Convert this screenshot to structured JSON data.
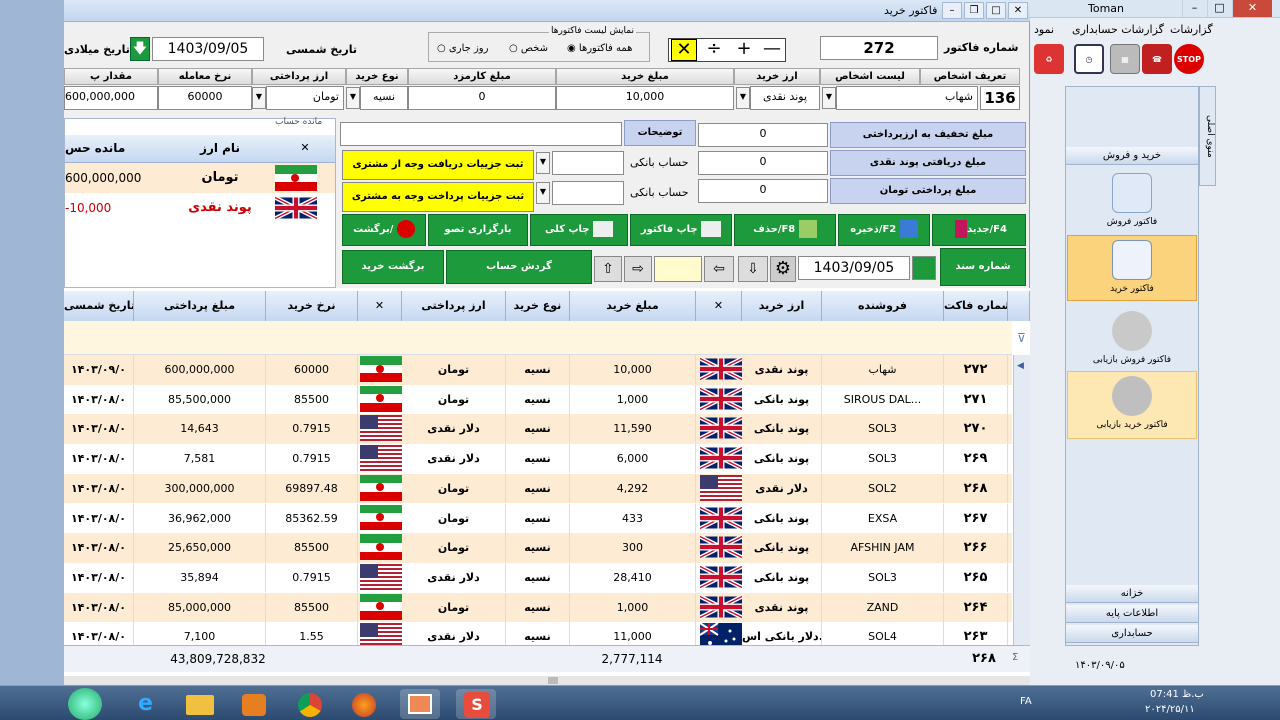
{
  "bg_app": {
    "title": "Toman",
    "menu": [
      "گزارشات",
      "گزارشات حسابداری",
      "نمود"
    ],
    "side_tab": "منوی اصلی",
    "panel_header": "خرید و فروش",
    "items": [
      "فاکتور فروش",
      "فاکتور خرید",
      "فاکتور فروش بازیابی",
      "فاکتور خرید بازیابی"
    ],
    "bottom_items": [
      "خزانه",
      "اطلاعات پایه",
      "حسابداری"
    ],
    "date": "۱۴۰۳/۰۹/۰۵",
    "stop_label": "STOP"
  },
  "window": {
    "title": "فاکتور خرید",
    "invoice_number_label": "شماره فاکتور",
    "invoice_number": "272",
    "list_group_title": "نمایش لیست فاکتورها",
    "radio_today": "روز جاری",
    "radio_person": "شخص",
    "radio_all": "همه فاکتورها",
    "shamsi_date_label": "تاریخ شمسی",
    "shamsi_date": "1403/09/05",
    "miladi_date_label": "تاریخ میلادی",
    "math_ops": [
      "—",
      "+",
      "÷",
      "✕"
    ]
  },
  "header_fields": {
    "labels": [
      "تعریف اشخاص",
      "لیست اشخاص",
      "ارز خرید",
      "مبلغ خرید",
      "مبلغ کارمزد",
      "نوع خرید",
      "ارز پرداختی",
      "نرخ معامله",
      "مقدار پ"
    ],
    "person_code": "136",
    "person_name": "شهاب",
    "buy_currency": "پوند نقدی",
    "buy_amount": "10,000",
    "fee": "0",
    "buy_type": "نسیه",
    "pay_currency": "تومان",
    "rate": "60000",
    "pay_amount": "600,000,000"
  },
  "payments": {
    "discount_label": "مبلغ تخفیف به ارزپرداختی",
    "discount": "0",
    "recv_label": "مبلغ دریافتی  پوند نقدی",
    "recv": "0",
    "paid_label": "مبلغ پرداختی  تومان",
    "paid": "0",
    "desc_label": "توضیحات",
    "bank1_label": "حساب بانکی",
    "bank2_label": "حساب بانکی",
    "recv_detail_btn": "ثبت جزییات دریافت وجه از مشتری",
    "pay_detail_btn": "ثبت جزییات پرداخت وجه به مشتری"
  },
  "balance": {
    "group_title": "مانده حساب",
    "col_name": "نام ارز",
    "col_balance": "مانده حس",
    "col_x": "✕",
    "rows": [
      {
        "name": "تومان",
        "value": "600,000,000",
        "flag": "ir"
      },
      {
        "name": "پوند نقدی",
        "value": "-10,000",
        "flag": "uk"
      }
    ]
  },
  "actions": {
    "new": "جدید/F4",
    "save": "ذخیره/F2",
    "delete": "حذف/F8",
    "print_invoice": "چاپ فاکتور",
    "print_all": "چاپ کلی",
    "reload": "بارگزاری تصو",
    "return": "برگشت/",
    "doc_label": "شماره سند",
    "doc_date": "1403/09/05",
    "turnover": "گردش حساب",
    "return_buy": "برگشت خرید"
  },
  "grid": {
    "columns": [
      "شماره فاکت",
      "فروشنده",
      "ارز خرید",
      "✕",
      "مبلغ خرید",
      "نوع خرید",
      "ارز پرداختی",
      "✕",
      "نرخ خرید",
      "مبلغ پرداختی",
      "تاریخ شمسی"
    ],
    "rows": [
      {
        "no": "۲۷۲",
        "seller": "شهاب",
        "cur": "پوند نقدی",
        "flag": "uk",
        "amount": "10,000",
        "type": "نسیه",
        "pay": "تومان",
        "pflag": "ir",
        "rate": "60000",
        "paid": "600,000,000",
        "date": "۱۴۰۳/۰۹/۰"
      },
      {
        "no": "۲۷۱",
        "seller": "SIROUS DAL...",
        "cur": "پوند بانکی",
        "flag": "uk",
        "amount": "1,000",
        "type": "نسیه",
        "pay": "تومان",
        "pflag": "ir",
        "rate": "85500",
        "paid": "85,500,000",
        "date": "۱۴۰۳/۰۸/۰"
      },
      {
        "no": "۲۷۰",
        "seller": "SOL3",
        "cur": "پوند بانکی",
        "flag": "uk",
        "amount": "11,590",
        "type": "نسیه",
        "pay": "دلار نقدی",
        "pflag": "us",
        "rate": "0.7915",
        "paid": "14,643",
        "date": "۱۴۰۳/۰۸/۰"
      },
      {
        "no": "۲۶۹",
        "seller": "SOL3",
        "cur": "پوند بانکی",
        "flag": "uk",
        "amount": "6,000",
        "type": "نسیه",
        "pay": "دلار نقدی",
        "pflag": "us",
        "rate": "0.7915",
        "paid": "7,581",
        "date": "۱۴۰۳/۰۸/۰"
      },
      {
        "no": "۲۶۸",
        "seller": "SOL2",
        "cur": "دلار نقدی",
        "flag": "us",
        "amount": "4,292",
        "type": "نسیه",
        "pay": "تومان",
        "pflag": "ir",
        "rate": "69897.48",
        "paid": "300,000,000",
        "date": "۱۴۰۳/۰۸/۰"
      },
      {
        "no": "۲۶۷",
        "seller": "EXSA",
        "cur": "پوند بانکی",
        "flag": "uk",
        "amount": "433",
        "type": "نسیه",
        "pay": "تومان",
        "pflag": "ir",
        "rate": "85362.59",
        "paid": "36,962,000",
        "date": "۱۴۰۳/۰۸/۰"
      },
      {
        "no": "۲۶۶",
        "seller": "AFSHIN JAM",
        "cur": "پوند بانکی",
        "flag": "uk",
        "amount": "300",
        "type": "نسیه",
        "pay": "تومان",
        "pflag": "ir",
        "rate": "85500",
        "paid": "25,650,000",
        "date": "۱۴۰۳/۰۸/۰"
      },
      {
        "no": "۲۶۵",
        "seller": "SOL3",
        "cur": "پوند بانکی",
        "flag": "uk",
        "amount": "28,410",
        "type": "نسیه",
        "pay": "دلار نقدی",
        "pflag": "us",
        "rate": "0.7915",
        "paid": "35,894",
        "date": "۱۴۰۳/۰۸/۰"
      },
      {
        "no": "۲۶۴",
        "seller": "ZAND",
        "cur": "پوند نقدی",
        "flag": "uk",
        "amount": "1,000",
        "type": "نسیه",
        "pay": "تومان",
        "pflag": "ir",
        "rate": "85500",
        "paid": "85,000,000",
        "date": "۱۴۰۳/۰۸/۰"
      },
      {
        "no": "۲۶۳",
        "seller": "SOL4",
        "cur": "دلار بانکی اس...",
        "flag": "au",
        "amount": "11,000",
        "type": "نسیه",
        "pay": "دلار نقدی",
        "pflag": "us",
        "rate": "1.55",
        "paid": "7,100",
        "date": "۱۴۰۳/۰۸/۰"
      }
    ],
    "footer": {
      "count": "۲۶۸",
      "amount_sum": "2,777,114",
      "paid_sum": "43,809,728,832"
    }
  },
  "taskbar": {
    "lang": "FA",
    "time": "07:41 ب.ظ",
    "date": "۲۰۲۴/۲۵/۱۱"
  },
  "colors": {
    "accent_green": "#1c9a3c",
    "yellow_btn": "#ffff00",
    "row_alt": "#fdebd3",
    "header_blue": "#c5d8f1"
  }
}
